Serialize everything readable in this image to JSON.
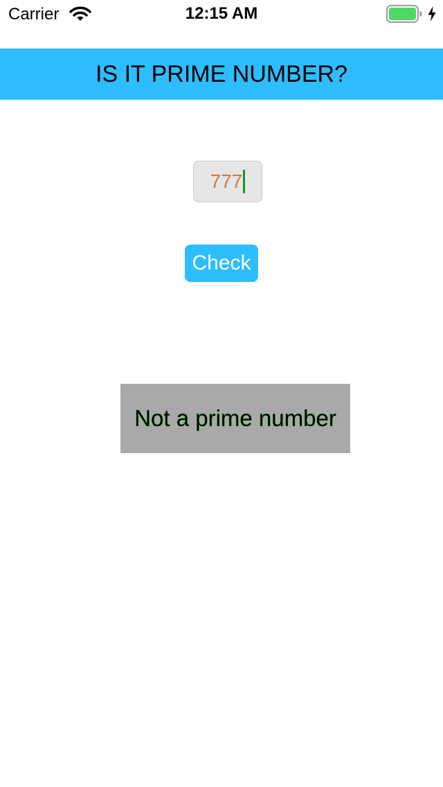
{
  "status_bar": {
    "carrier": "Carrier",
    "time": "12:15 AM",
    "wifi_icon": "wifi-icon",
    "battery_icon": "battery-icon",
    "charging_icon": "charging-bolt-icon",
    "battery_color": "#4cd964"
  },
  "header": {
    "title": "IS IT PRIME NUMBER?",
    "background": "#2ebdff"
  },
  "number_field": {
    "value": "777",
    "text_color": "#d07a3e",
    "cursor_color": "#1f8f2a"
  },
  "check_button": {
    "label": "Check",
    "background": "#2ebdff"
  },
  "result": {
    "text": "Not a prime number",
    "background": "#a9a9a9",
    "text_color": "#000000",
    "glow_color": "#2fd12f"
  }
}
